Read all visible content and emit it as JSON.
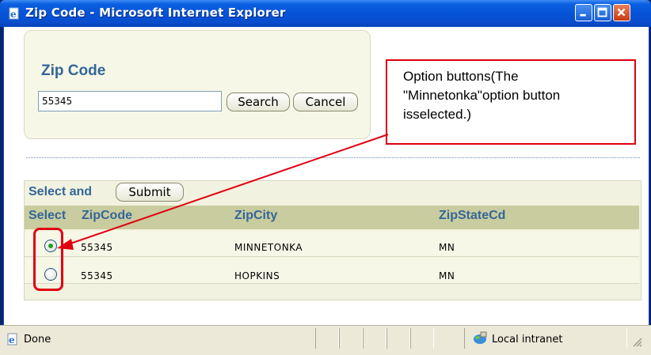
{
  "window": {
    "title": "Zip Code - Microsoft Internet Explorer",
    "controls": [
      "minimize-icon",
      "maximize-icon",
      "close-icon"
    ]
  },
  "search_panel": {
    "title": "Zip Code",
    "input_value": "55345",
    "search_label": "Search",
    "cancel_label": "Cancel"
  },
  "results": {
    "heading": "Select and",
    "submit_label": "Submit",
    "columns": [
      "Select",
      "ZipCode",
      "ZipCity",
      "ZipStateCd"
    ],
    "rows": [
      {
        "selected": true,
        "zipcode": "55345",
        "city": "MINNETONKA",
        "state": "MN"
      },
      {
        "selected": false,
        "zipcode": "55345",
        "city": "HOPKINS",
        "state": "MN"
      }
    ]
  },
  "callout": {
    "text": "Option buttons(The \"Minnetonka\"option button isselected.)",
    "border_color": "#e00010"
  },
  "statusbar": {
    "status": "Done",
    "zone": "Local intranet"
  },
  "colors": {
    "titlebar": "#0552d6",
    "heading": "#336699",
    "panel_bg": "#f7f7e7",
    "header_bg": "#c9cc9e"
  }
}
